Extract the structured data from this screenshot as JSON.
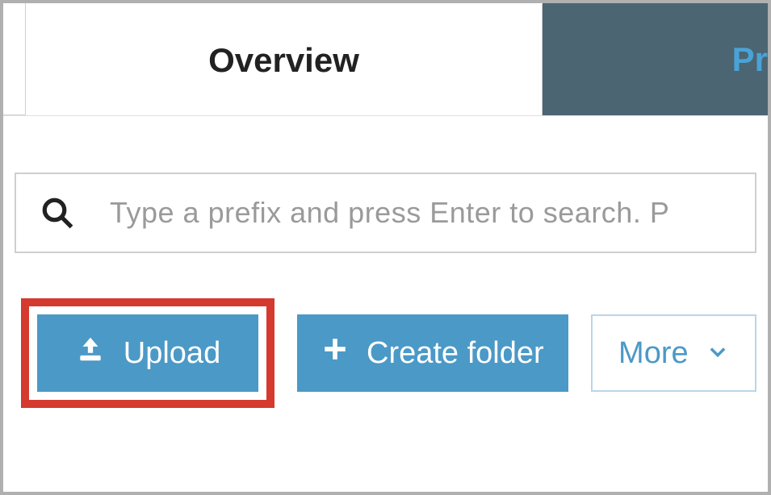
{
  "tabs": {
    "active": "Overview",
    "inactive_partial": "Pr"
  },
  "search": {
    "placeholder": "Type a prefix and press Enter to search. P"
  },
  "buttons": {
    "upload": "Upload",
    "create_folder": "Create folder",
    "more": "More"
  },
  "colors": {
    "primary_button": "#4b99c7",
    "highlight_border": "#d43a2e",
    "inactive_tab_bg": "#4b6573",
    "inactive_tab_text": "#4aa3d6"
  }
}
